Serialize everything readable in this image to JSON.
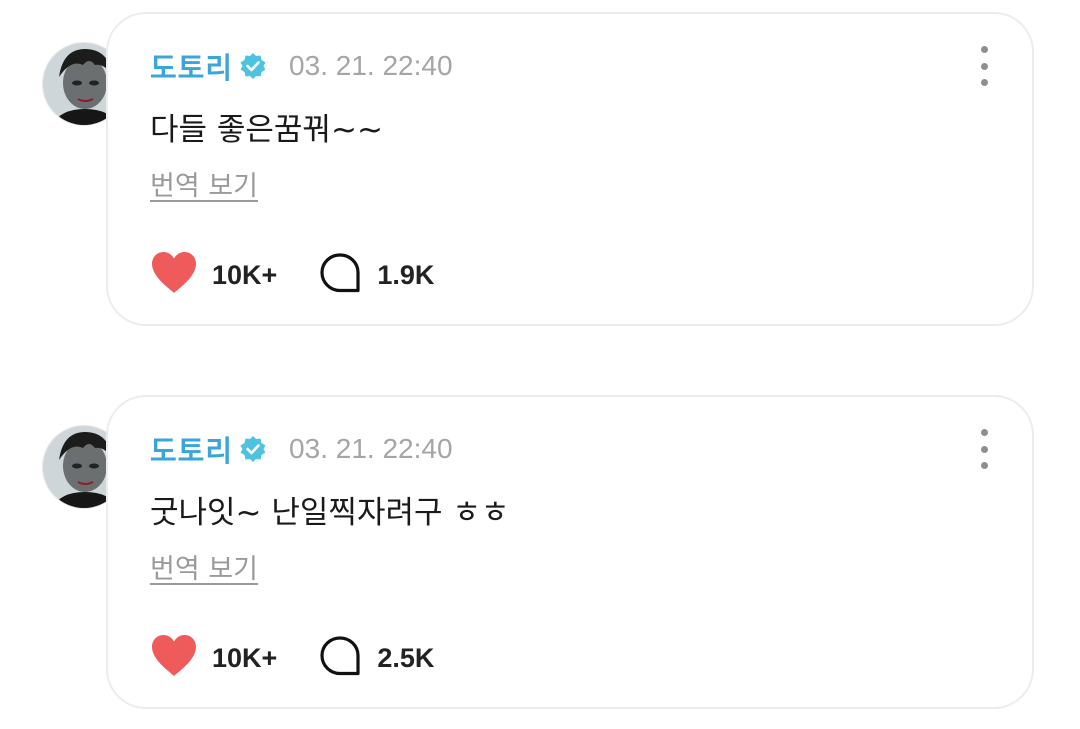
{
  "posts": [
    {
      "author": "도토리",
      "timestamp": "03. 21. 22:40",
      "content": "다들 좋은꿈꿔~~",
      "translate_label": "번역 보기",
      "likes": "10K+",
      "comments": "1.9K"
    },
    {
      "author": "도토리",
      "timestamp": "03. 21. 22:40",
      "content": "굿나잇~ 난일찍자려구 ㅎㅎ",
      "translate_label": "번역 보기",
      "likes": "10K+",
      "comments": "2.5K"
    }
  ],
  "colors": {
    "author": "#3aa5d8",
    "verified_badge": "#4ec3e0",
    "heart": "#ef5a5a",
    "timestamp": "#a5a5a5"
  },
  "icons": {
    "verified": "verified-badge-icon",
    "more": "more-vertical-icon",
    "like": "heart-icon",
    "comment": "comment-bubble-icon"
  }
}
